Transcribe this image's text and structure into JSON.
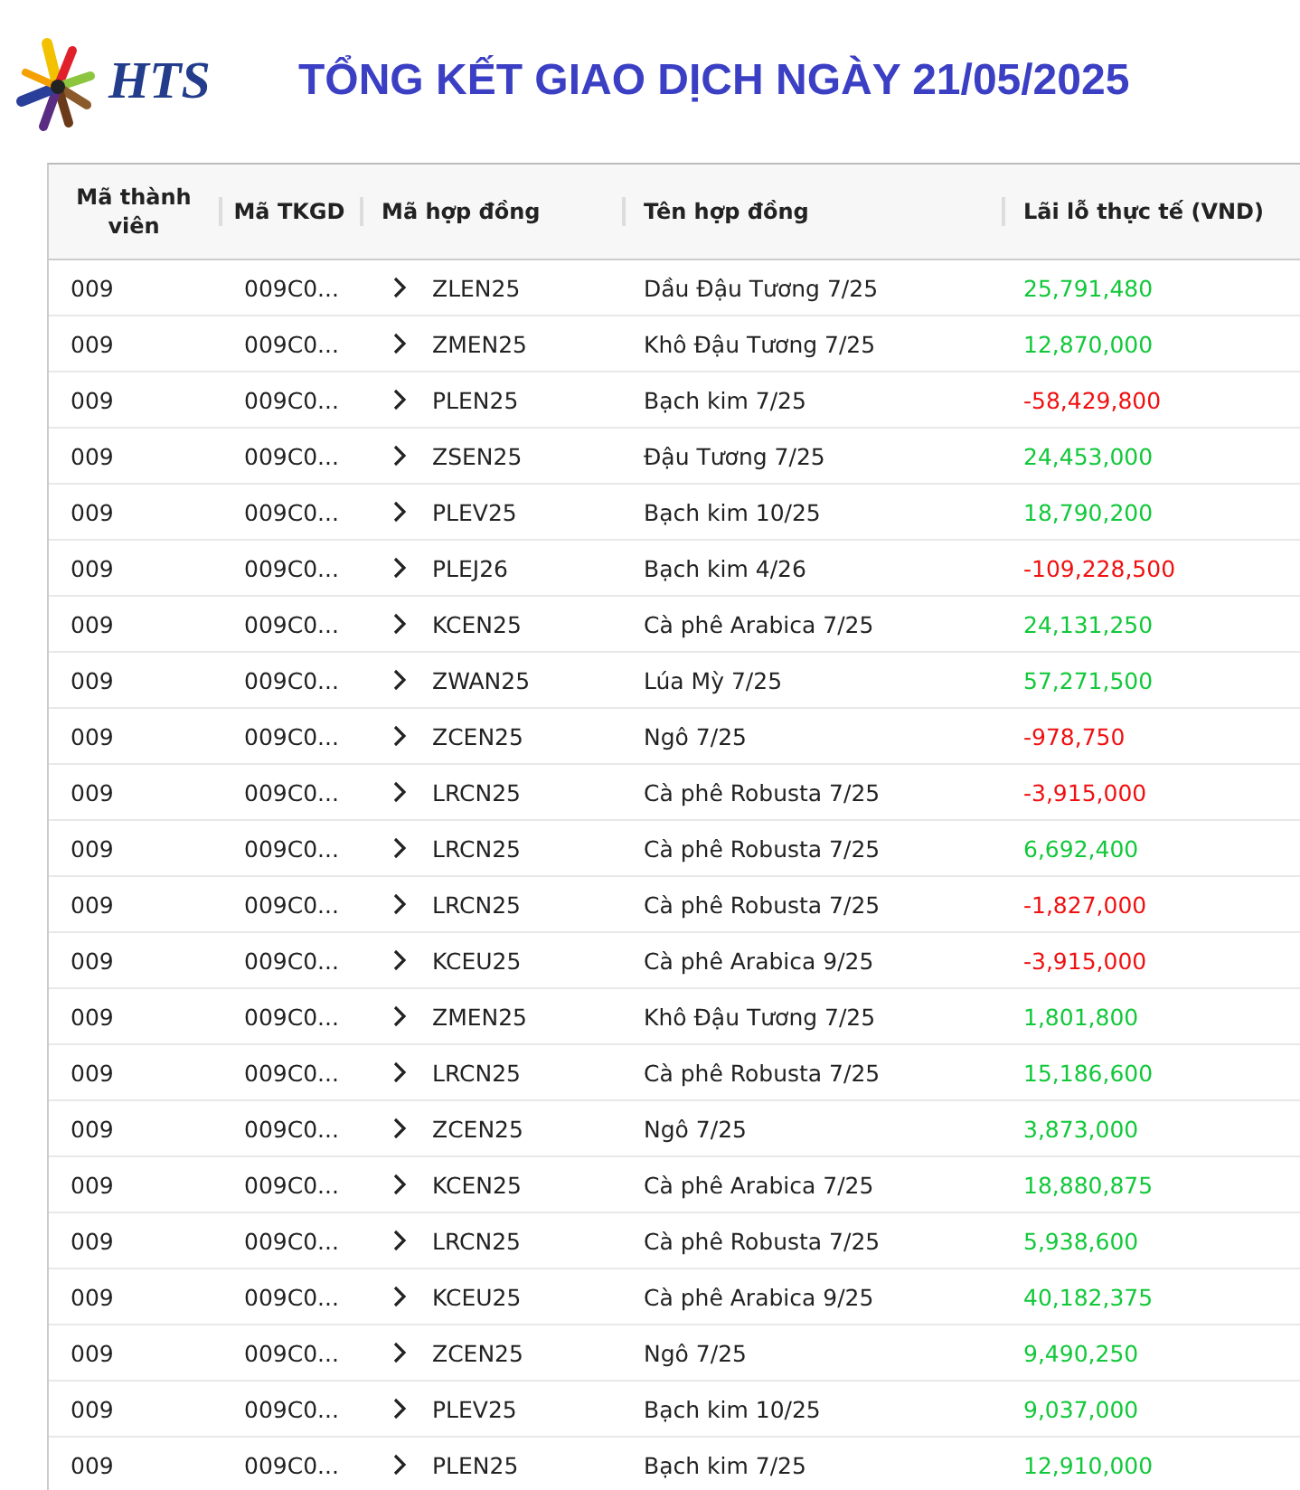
{
  "header": {
    "logo_text": "HTS",
    "title": "TỔNG KẾT GIAO DỊCH NGÀY 21/05/2025"
  },
  "table": {
    "columns": [
      "Mã thành viên",
      "Mã TKGD",
      "Mã hợp đồng",
      "Tên hợp đồng",
      "Lãi lỗ thực tế (VND)"
    ],
    "rows": [
      {
        "member": "009",
        "account": "009C0...",
        "contract_code": "ZLEN25",
        "contract_name": "Dầu Đậu Tương 7/25",
        "pnl": "25,791,480",
        "kind": "gain"
      },
      {
        "member": "009",
        "account": "009C0...",
        "contract_code": "ZMEN25",
        "contract_name": "Khô Đậu Tương 7/25",
        "pnl": "12,870,000",
        "kind": "gain"
      },
      {
        "member": "009",
        "account": "009C0...",
        "contract_code": "PLEN25",
        "contract_name": "Bạch kim 7/25",
        "pnl": "-58,429,800",
        "kind": "loss"
      },
      {
        "member": "009",
        "account": "009C0...",
        "contract_code": "ZSEN25",
        "contract_name": "Đậu Tương 7/25",
        "pnl": "24,453,000",
        "kind": "gain"
      },
      {
        "member": "009",
        "account": "009C0...",
        "contract_code": "PLEV25",
        "contract_name": "Bạch kim 10/25",
        "pnl": "18,790,200",
        "kind": "gain"
      },
      {
        "member": "009",
        "account": "009C0...",
        "contract_code": "PLEJ26",
        "contract_name": "Bạch kim 4/26",
        "pnl": "-109,228,500",
        "kind": "loss"
      },
      {
        "member": "009",
        "account": "009C0...",
        "contract_code": "KCEN25",
        "contract_name": "Cà phê Arabica 7/25",
        "pnl": "24,131,250",
        "kind": "gain"
      },
      {
        "member": "009",
        "account": "009C0...",
        "contract_code": "ZWAN25",
        "contract_name": "Lúa Mỳ 7/25",
        "pnl": "57,271,500",
        "kind": "gain"
      },
      {
        "member": "009",
        "account": "009C0...",
        "contract_code": "ZCEN25",
        "contract_name": "Ngô 7/25",
        "pnl": "-978,750",
        "kind": "loss"
      },
      {
        "member": "009",
        "account": "009C0...",
        "contract_code": "LRCN25",
        "contract_name": "Cà phê Robusta 7/25",
        "pnl": "-3,915,000",
        "kind": "loss"
      },
      {
        "member": "009",
        "account": "009C0...",
        "contract_code": "LRCN25",
        "contract_name": "Cà phê Robusta 7/25",
        "pnl": "6,692,400",
        "kind": "gain"
      },
      {
        "member": "009",
        "account": "009C0...",
        "contract_code": "LRCN25",
        "contract_name": "Cà phê Robusta 7/25",
        "pnl": "-1,827,000",
        "kind": "loss"
      },
      {
        "member": "009",
        "account": "009C0...",
        "contract_code": "KCEU25",
        "contract_name": "Cà phê Arabica 9/25",
        "pnl": "-3,915,000",
        "kind": "loss"
      },
      {
        "member": "009",
        "account": "009C0...",
        "contract_code": "ZMEN25",
        "contract_name": "Khô Đậu Tương 7/25",
        "pnl": "1,801,800",
        "kind": "gain"
      },
      {
        "member": "009",
        "account": "009C0...",
        "contract_code": "LRCN25",
        "contract_name": "Cà phê Robusta 7/25",
        "pnl": "15,186,600",
        "kind": "gain"
      },
      {
        "member": "009",
        "account": "009C0...",
        "contract_code": "ZCEN25",
        "contract_name": "Ngô 7/25",
        "pnl": "3,873,000",
        "kind": "gain"
      },
      {
        "member": "009",
        "account": "009C0...",
        "contract_code": "KCEN25",
        "contract_name": "Cà phê Arabica 7/25",
        "pnl": "18,880,875",
        "kind": "gain"
      },
      {
        "member": "009",
        "account": "009C0...",
        "contract_code": "LRCN25",
        "contract_name": "Cà phê Robusta 7/25",
        "pnl": "5,938,600",
        "kind": "gain"
      },
      {
        "member": "009",
        "account": "009C0...",
        "contract_code": "KCEU25",
        "contract_name": "Cà phê Arabica 9/25",
        "pnl": "40,182,375",
        "kind": "gain"
      },
      {
        "member": "009",
        "account": "009C0...",
        "contract_code": "ZCEN25",
        "contract_name": "Ngô 7/25",
        "pnl": "9,490,250",
        "kind": "gain"
      },
      {
        "member": "009",
        "account": "009C0...",
        "contract_code": "PLEV25",
        "contract_name": "Bạch kim 10/25",
        "pnl": "9,037,000",
        "kind": "gain"
      },
      {
        "member": "009",
        "account": "009C0...",
        "contract_code": "PLEN25",
        "contract_name": "Bạch kim 7/25",
        "pnl": "12,910,000",
        "kind": "gain"
      }
    ]
  }
}
